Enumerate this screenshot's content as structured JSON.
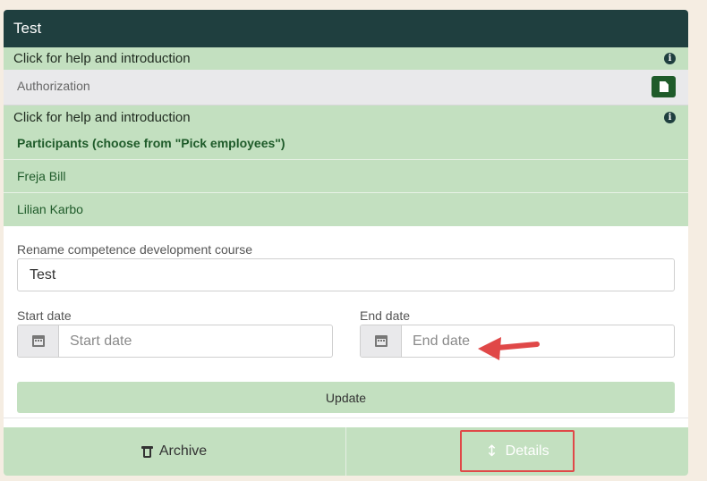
{
  "card": {
    "title": "Test",
    "help_text": "Click for help and introduction",
    "authorization_label": "Authorization"
  },
  "participants": {
    "help_text": "Click for help and introduction",
    "title": "Participants (choose from \"Pick employees\")",
    "people": [
      "Freja Bill",
      "Lilian Karbo"
    ]
  },
  "form": {
    "rename_label": "Rename competence development course",
    "rename_value": "Test",
    "start_label": "Start date",
    "start_placeholder": "Start date",
    "end_label": "End date",
    "end_placeholder": "End date",
    "update_label": "Update"
  },
  "footer": {
    "archive_label": "Archive",
    "details_label": "Details"
  },
  "icons": {
    "info": "info-icon",
    "document": "document-icon",
    "calendar": "calendar-icon",
    "trash": "trash-icon",
    "arrows": "vertical-arrows-icon"
  },
  "colors": {
    "header": "#1f3f3f",
    "accent_green": "#c3e0c0",
    "participant_text": "#1f5b2a",
    "annotation_red": "#e04848"
  }
}
